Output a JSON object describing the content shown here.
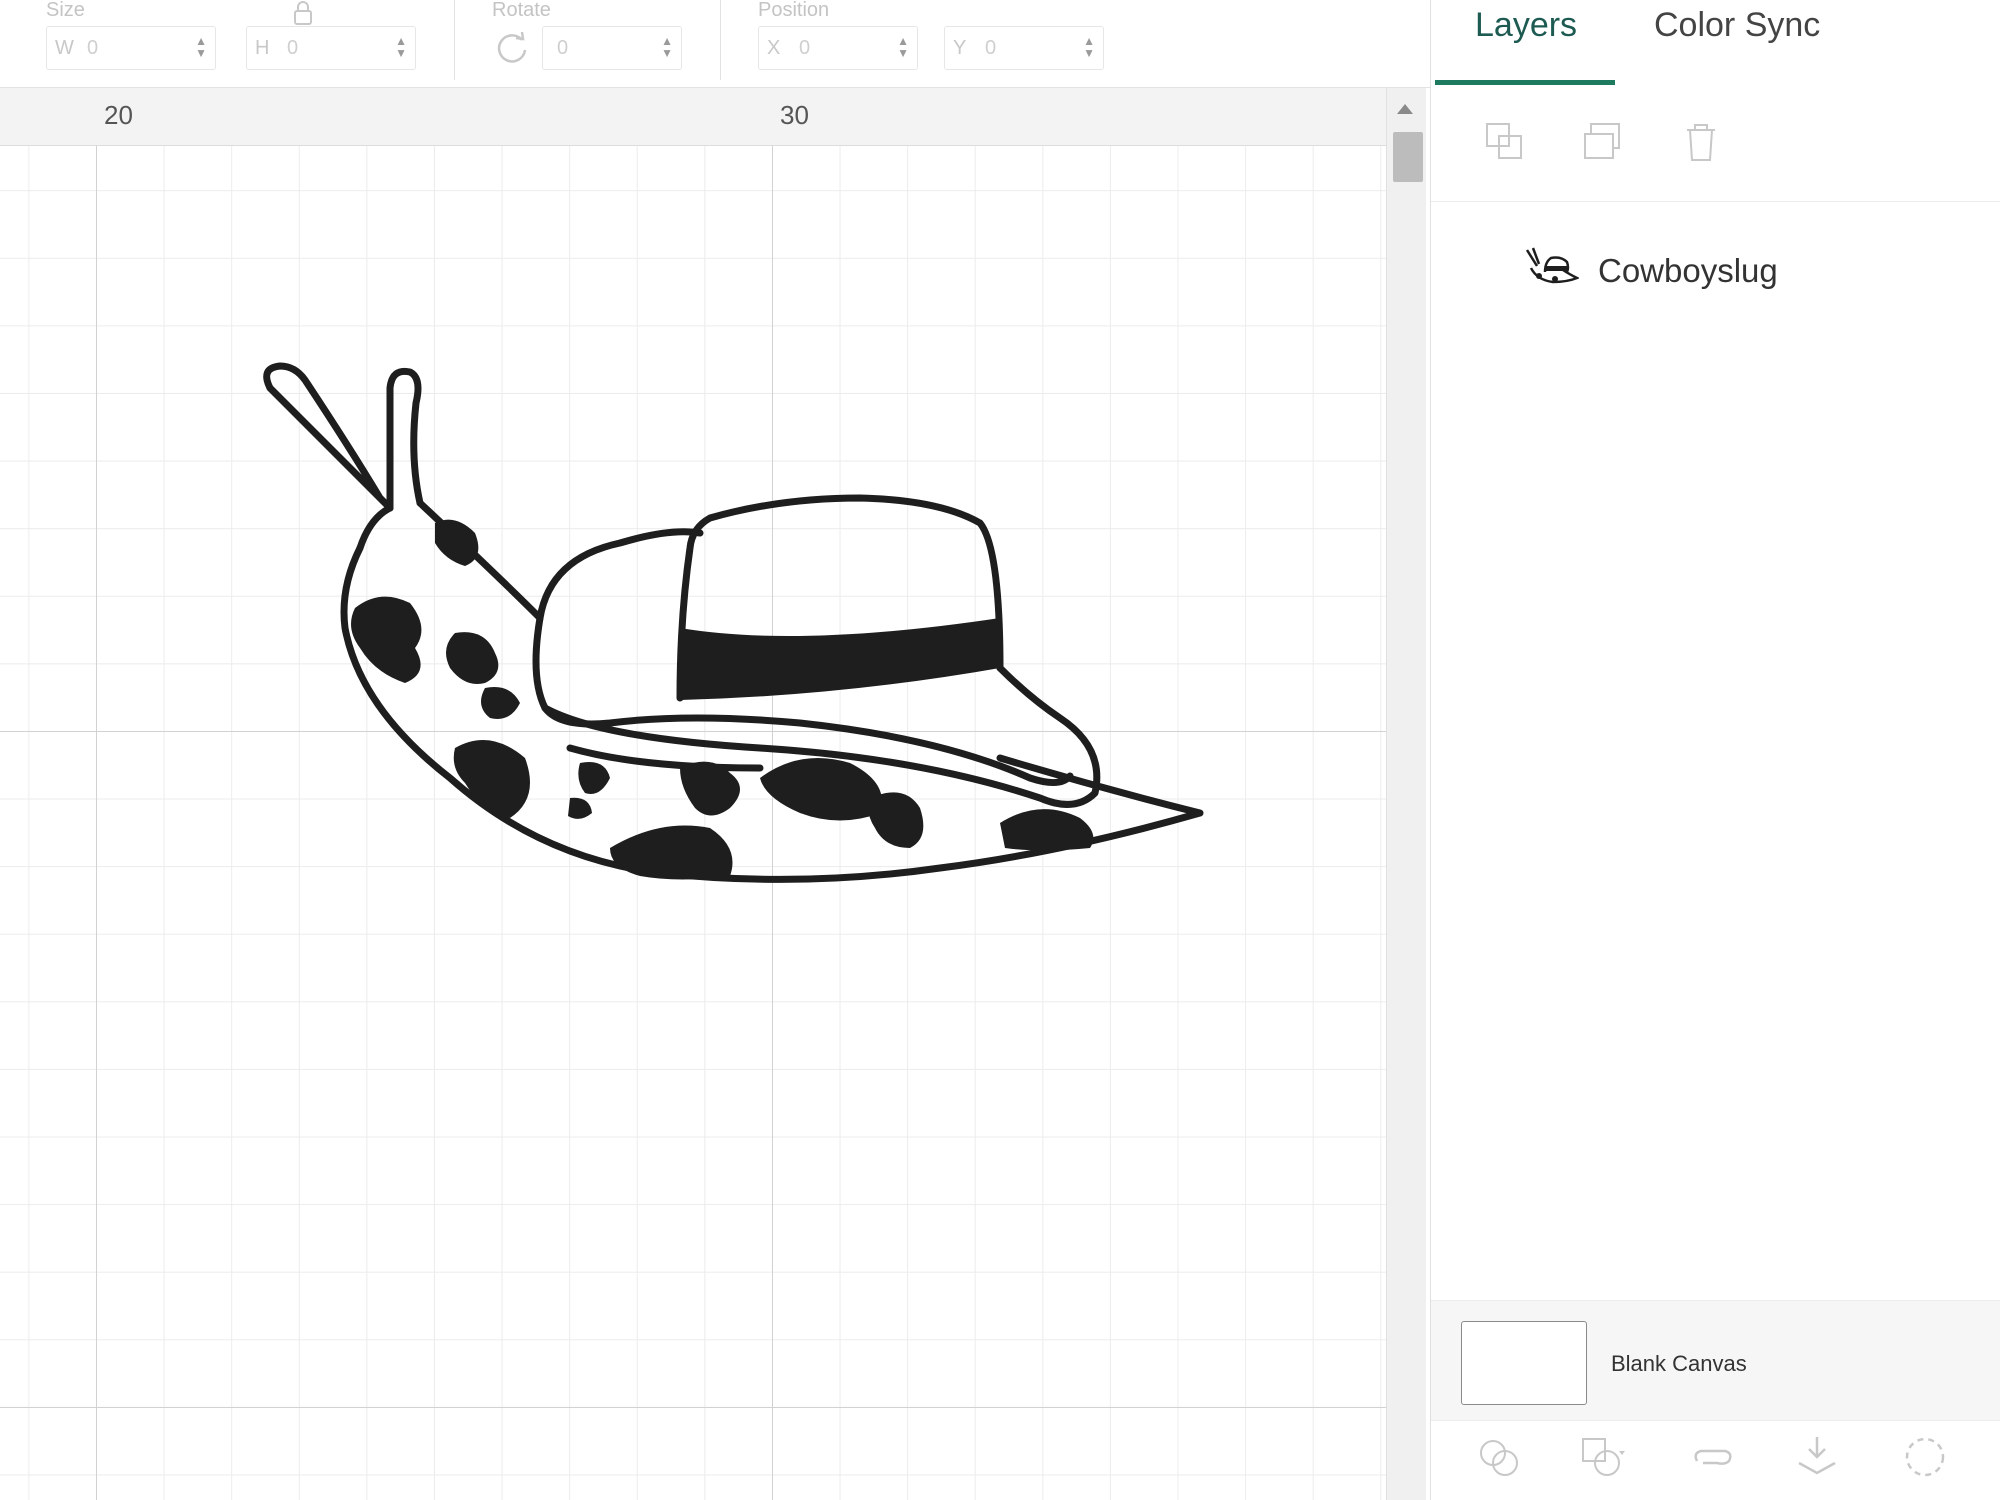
{
  "toolbar": {
    "size": {
      "label": "Size",
      "w_prefix": "W",
      "w_value": "0",
      "h_prefix": "H",
      "h_value": "0"
    },
    "rotate": {
      "label": "Rotate",
      "value": "0"
    },
    "position": {
      "label": "Position",
      "x_prefix": "X",
      "x_value": "0",
      "y_prefix": "Y",
      "y_value": "0"
    }
  },
  "ruler": {
    "labels": [
      "20",
      "30"
    ]
  },
  "panel": {
    "tabs": {
      "layers": "Layers",
      "color_sync": "Color Sync"
    },
    "tool_icons": [
      "group-icon",
      "duplicate-icon",
      "delete-icon"
    ],
    "layers": [
      {
        "name": "Cowboyslug"
      }
    ],
    "blank_canvas": {
      "label": "Blank Canvas"
    },
    "bottom_icons": [
      "slice-icon",
      "combine-icon",
      "attach-icon",
      "flatten-icon",
      "contour-icon"
    ]
  },
  "colors": {
    "accent": "#1e7a5f",
    "active_tab_text": "#1d5b52",
    "artwork": "#1e1e1e"
  }
}
